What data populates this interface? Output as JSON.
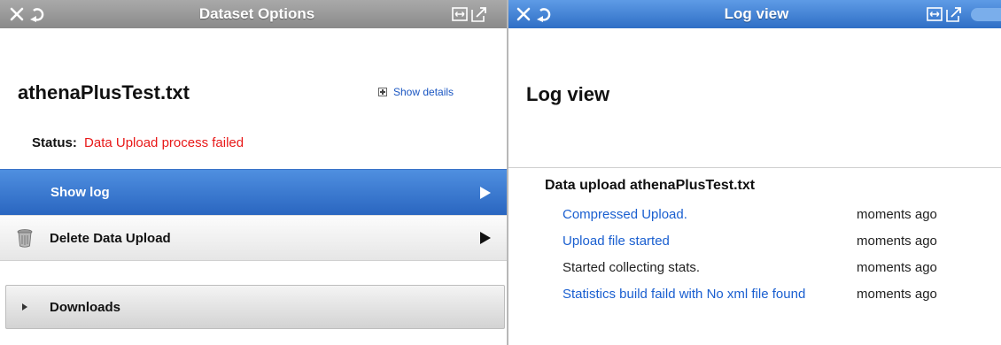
{
  "left_panel": {
    "title": "Dataset Options",
    "dataset_name": "athenaPlusTest.txt",
    "show_details": "Show details",
    "status_label": "Status:",
    "status_value": "Data Upload process failed",
    "actions": [
      {
        "label": "Show log",
        "selected": true
      },
      {
        "label": "Delete Data Upload",
        "icon": "trash-icon"
      }
    ],
    "downloads_label": "Downloads",
    "header_color": "#9a9a9a"
  },
  "right_panel": {
    "title": "Log view",
    "heading": "Log view",
    "section_title": "Data upload athenaPlusTest.txt",
    "entries": [
      {
        "message": "Compressed Upload.",
        "time": "moments ago",
        "link": true
      },
      {
        "message": "Upload file started",
        "time": "moments ago",
        "link": true
      },
      {
        "message": "Started collecting stats.",
        "time": "moments ago",
        "link": false
      },
      {
        "message": "Statistics build faild with No xml file found",
        "time": "moments ago",
        "link": true
      }
    ],
    "header_color": "#3f7fd4"
  },
  "colors": {
    "accent_blue": "#2a66c0",
    "link_blue": "#1a5fd0",
    "error_red": "#e81818"
  },
  "icons": {
    "close": "close-icon",
    "refresh": "refresh-icon",
    "expand": "expand-icon",
    "popout": "popout-icon"
  }
}
